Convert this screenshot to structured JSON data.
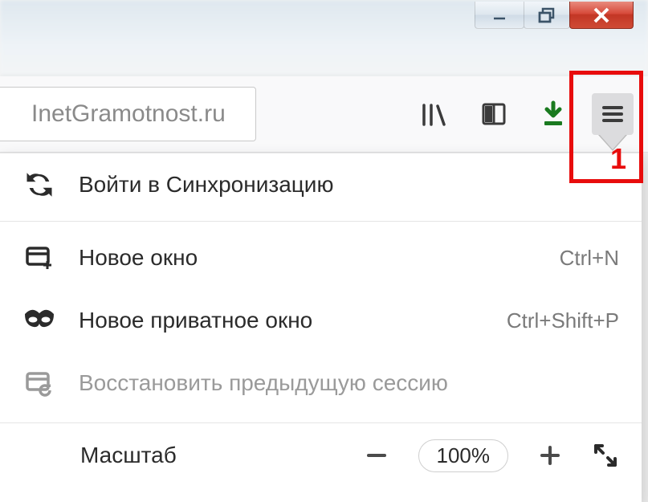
{
  "url_display": "InetGramotnost.ru",
  "windowControls": {
    "minimize": "minimize",
    "maximize": "maximize",
    "close": "close"
  },
  "toolbar": {
    "library_icon": "library",
    "sidebar_icon": "sidebar",
    "downloads_icon": "downloads",
    "menu_icon": "menu"
  },
  "annotation": {
    "number": "1"
  },
  "menu": {
    "sync": {
      "label": "Войти в Синхронизацию"
    },
    "new_window": {
      "label": "Новое окно",
      "shortcut": "Ctrl+N"
    },
    "new_private": {
      "label": "Новое приватное окно",
      "shortcut": "Ctrl+Shift+P"
    },
    "restore": {
      "label": "Восстановить предыдущую сессию"
    },
    "zoom": {
      "label": "Масштаб",
      "value": "100%"
    }
  }
}
